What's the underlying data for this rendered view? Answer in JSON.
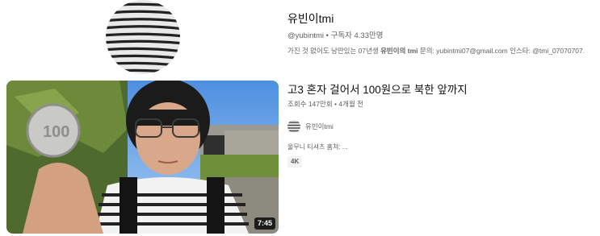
{
  "channel": {
    "name": "유빈이tmi",
    "handle": "@yubintmi",
    "separator": "•",
    "subscribers": "구독자 4.33만명",
    "description_prefix": "가진 것 없어도 낭만있는 07년생 ",
    "description_bold": "유빈이의 tmi",
    "description_suffix": " 문의: yubintmi07@gmail.com 인스타: @tmi_07070707."
  },
  "video": {
    "title": "고3 혼자 걸어서 100원으로 북한 앞까지",
    "views": "조회수 147만회",
    "separator": "•",
    "age": "4개월 전",
    "channel_name": "유빈이tmi",
    "snippet": "울무니 티셔츠 훔쳐: ...",
    "badge": "4K",
    "duration": "7:45"
  }
}
